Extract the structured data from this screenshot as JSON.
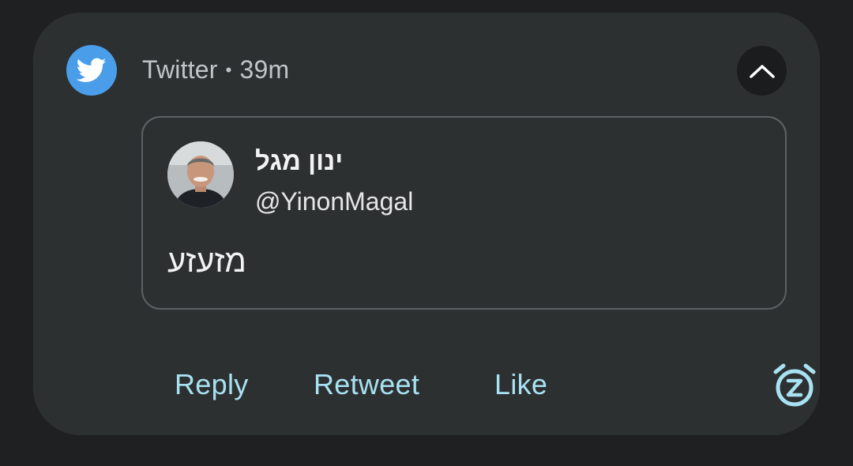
{
  "notification": {
    "app_name": "Twitter",
    "separator": "•",
    "time_ago": "39m",
    "app_icon": "twitter-bird-icon",
    "collapse_icon": "chevron-up-icon"
  },
  "tweet": {
    "author_name": "ינון מגל",
    "author_handle": "@YinonMagal",
    "text": "מזעזע"
  },
  "actions": {
    "reply": "Reply",
    "retweet": "Retweet",
    "like": "Like",
    "snooze_icon": "snooze-alarm-icon"
  },
  "colors": {
    "background": "#1f2021",
    "card": "#2d3031",
    "twitter_blue": "#4a9ee9",
    "action_text": "#a8e2f2"
  }
}
